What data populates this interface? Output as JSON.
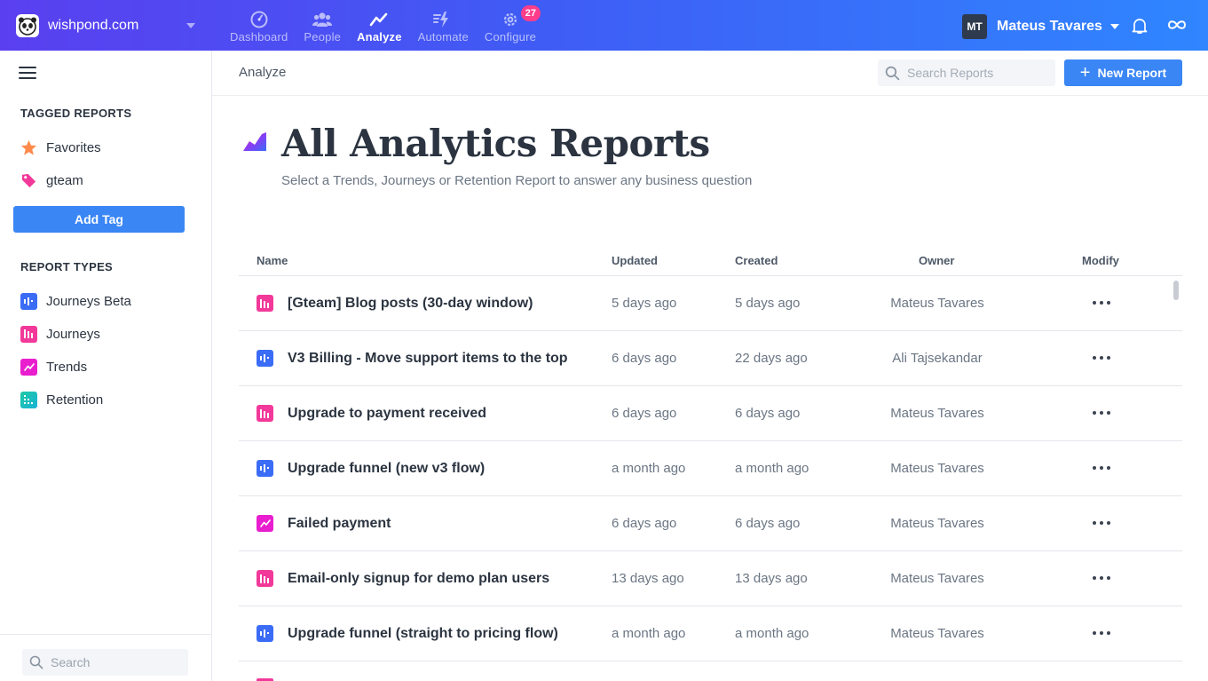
{
  "topbar": {
    "org_name": "wishpond.com",
    "nav": [
      {
        "label": "Dashboard",
        "icon": "dashboard-icon",
        "active": false
      },
      {
        "label": "People",
        "icon": "people-icon",
        "active": false
      },
      {
        "label": "Analyze",
        "icon": "analyze-icon",
        "active": true
      },
      {
        "label": "Automate",
        "icon": "automate-icon",
        "active": false
      },
      {
        "label": "Configure",
        "icon": "gear-icon",
        "active": false,
        "badge": "27"
      }
    ],
    "user": {
      "initials": "MT",
      "name": "Mateus Tavares"
    }
  },
  "sidebar": {
    "tagged_heading": "TAGGED REPORTS",
    "tags": [
      {
        "label": "Favorites",
        "icon": "star-icon",
        "color": "#ff8a4c"
      },
      {
        "label": "gteam",
        "icon": "tag-icon",
        "color": "#f2399a"
      }
    ],
    "add_tag_label": "Add Tag",
    "types_heading": "REPORT TYPES",
    "types": [
      {
        "label": "Journeys Beta",
        "icon": "journeys-beta-icon",
        "color": "#3b6cf6"
      },
      {
        "label": "Journeys",
        "icon": "journeys-icon",
        "color": "#f2399a"
      },
      {
        "label": "Trends",
        "icon": "trends-icon",
        "color": "#e91ecf"
      },
      {
        "label": "Retention",
        "icon": "retention-icon",
        "color": "#1dc9a4"
      }
    ],
    "search_placeholder": "Search"
  },
  "main": {
    "breadcrumb": "Analyze",
    "search_placeholder": "Search Reports",
    "new_report_label": "New Report",
    "title": "All Analytics Reports",
    "subtitle": "Select a Trends, Journeys or Retention Report to answer any business question",
    "columns": {
      "name": "Name",
      "updated": "Updated",
      "created": "Created",
      "owner": "Owner",
      "modify": "Modify"
    },
    "rows": [
      {
        "name": "[Gteam] Blog posts (30-day window)",
        "type": "journeys",
        "updated": "5 days ago",
        "created": "5 days ago",
        "owner": "Mateus Tavares"
      },
      {
        "name": "V3 Billing - Move support items to the top",
        "type": "journeys-beta",
        "updated": "6 days ago",
        "created": "22 days ago",
        "owner": "Ali Tajsekandar"
      },
      {
        "name": "Upgrade to payment received",
        "type": "journeys",
        "updated": "6 days ago",
        "created": "6 days ago",
        "owner": "Mateus Tavares"
      },
      {
        "name": "Upgrade funnel (new v3 flow)",
        "type": "journeys-beta",
        "updated": "a month ago",
        "created": "a month ago",
        "owner": "Mateus Tavares"
      },
      {
        "name": "Failed payment",
        "type": "trends",
        "updated": "6 days ago",
        "created": "6 days ago",
        "owner": "Mateus Tavares"
      },
      {
        "name": "Email-only signup for demo plan users",
        "type": "journeys",
        "updated": "13 days ago",
        "created": "13 days ago",
        "owner": "Mateus Tavares"
      },
      {
        "name": "Upgrade funnel (straight to pricing flow)",
        "type": "journeys-beta",
        "updated": "a month ago",
        "created": "a month ago",
        "owner": "Mateus Tavares"
      }
    ]
  },
  "colors": {
    "accent": "#3a86f5",
    "journeys": "#f2399a",
    "journeys_beta": "#3b6cf6",
    "trends": "#e91ecf",
    "retention": "#1dc9a4"
  }
}
